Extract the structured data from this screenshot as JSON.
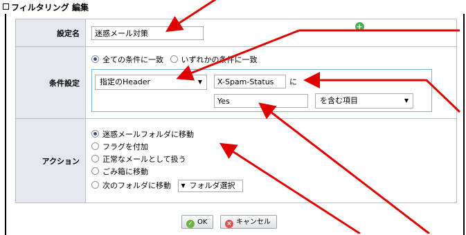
{
  "panel": {
    "title": "フィルタリング 編集"
  },
  "fields": {
    "name_label": "設定名",
    "name_value": "迷惑メール対策",
    "condition_label": "条件設定",
    "match_all": "全ての条件に一致",
    "match_any": "いずれかの条件に一致",
    "match_selected": "match_all",
    "header_select": "指定のHeader",
    "header_name": "X-Spam-Status",
    "particle": "に",
    "header_value": "Yes",
    "operator_select": "を含む項目",
    "action_label": "アクション",
    "actions": [
      {
        "label": "迷惑メールフォルダに移動",
        "checked": true
      },
      {
        "label": "フラグを付加",
        "checked": false
      },
      {
        "label": "正常なメールとして扱う",
        "checked": false
      },
      {
        "label": "ごみ箱に移動",
        "checked": false
      },
      {
        "label": "次のフォルダに移動",
        "checked": false
      }
    ],
    "folder_select": "フォルダ選択"
  },
  "buttons": {
    "ok": "OK",
    "cancel": "キャンセル"
  },
  "colors": {
    "annotation": "#e00000",
    "label_bg": "#e4e8ee",
    "add_icon": "#4caf50"
  }
}
